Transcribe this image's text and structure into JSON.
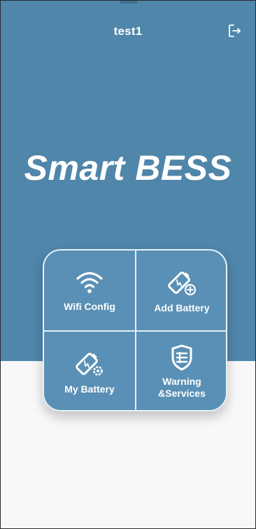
{
  "header": {
    "title": "test1",
    "logout_icon": "logout-icon"
  },
  "hero": {
    "brand": "Smart BESS"
  },
  "menu": {
    "tiles": [
      {
        "label": "Wifi Config",
        "icon": "wifi-icon"
      },
      {
        "label": "Add Battery",
        "icon": "battery-add-icon"
      },
      {
        "label": "My Battery",
        "icon": "battery-settings-icon"
      },
      {
        "label": "Warning\n&Services",
        "icon": "shield-list-icon"
      }
    ]
  },
  "colors": {
    "primary": "#4f86aa",
    "tile": "#5a90b5",
    "background": "#f8f8f8"
  }
}
